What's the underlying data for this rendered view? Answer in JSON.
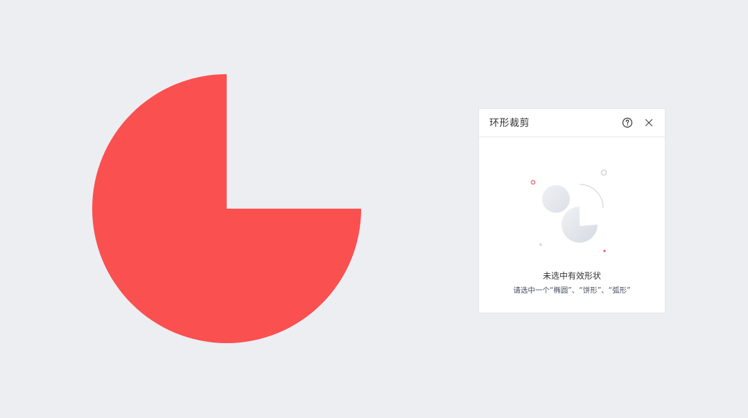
{
  "canvas": {
    "shape_color": "#FA5050",
    "background_color": "#ECEEF2"
  },
  "panel": {
    "title": "环形裁剪",
    "help_icon": "help-circle-icon",
    "close_icon": "close-icon",
    "empty_state": {
      "illustration_icon": "empty-shapes-illustration",
      "title": "未选中有效形状",
      "description": "请选中一个“椭圆”、“饼形”、“弧形”",
      "accent_color": "#FA5050"
    }
  }
}
